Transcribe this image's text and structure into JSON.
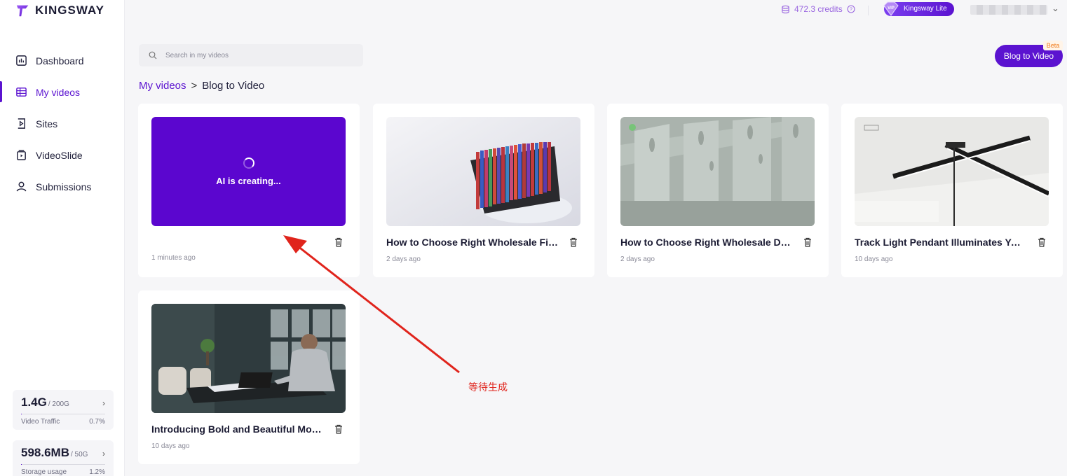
{
  "brand": {
    "name": "KINGSWAY",
    "accent": "#5b13d0"
  },
  "sidebar": {
    "items": [
      {
        "label": "Dashboard",
        "icon": "dashboard-icon",
        "active": false
      },
      {
        "label": "My videos",
        "icon": "video-grid-icon",
        "active": true
      },
      {
        "label": "Sites",
        "icon": "sites-icon",
        "active": false
      },
      {
        "label": "VideoSlide",
        "icon": "slide-icon",
        "active": false
      },
      {
        "label": "Submissions",
        "icon": "user-icon",
        "active": false
      }
    ],
    "usage": [
      {
        "value": "1.4G",
        "total": "/ 200G",
        "label": "Video Traffic",
        "percent": "0.7%",
        "fraction": 0.007
      },
      {
        "value": "598.6MB",
        "total": "/ 50G",
        "label": "Storage usage",
        "percent": "1.2%",
        "fraction": 0.012
      }
    ]
  },
  "header": {
    "credits": "472.3 credits",
    "plan": "Kingsway Lite",
    "vip": "VIP"
  },
  "search": {
    "placeholder": "Search in my videos"
  },
  "toolbar": {
    "blog_button": "Blog to Video",
    "beta_badge": "Beta"
  },
  "breadcrumb": {
    "root": "My videos",
    "separator": ">",
    "current": "Blog to Video"
  },
  "videos": [
    {
      "status": "creating",
      "status_text": "AI is creating...",
      "title": "",
      "time": "1 minutes ago"
    },
    {
      "status": "done",
      "title": "How to Choose Right Wholesale File Organizers",
      "time": "2 days ago"
    },
    {
      "status": "done",
      "title": "How to Choose Right Wholesale Desk Organizers",
      "time": "2 days ago"
    },
    {
      "status": "done",
      "title": "Track Light Pendant Illuminates Your Space",
      "time": "10 days ago"
    },
    {
      "status": "done",
      "title": "Introducing Bold and Beautiful Modern Office",
      "time": "10 days ago"
    }
  ],
  "annotation": {
    "text": "等待生成",
    "color": "#e0241c"
  }
}
